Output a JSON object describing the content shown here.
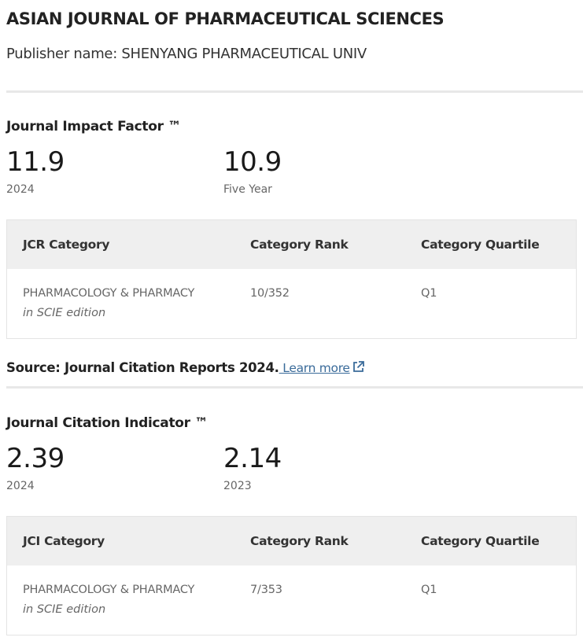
{
  "journal": {
    "title": "ASIAN JOURNAL OF PHARMACEUTICAL SCIENCES",
    "publisher": "Publisher name: SHENYANG PHARMACEUTICAL UNIV"
  },
  "jif": {
    "heading": "Journal Impact Factor ™",
    "primary": {
      "value": "11.9",
      "label": "2024"
    },
    "secondary": {
      "value": "10.9",
      "label": "Five Year"
    },
    "table": {
      "headers": [
        "JCR Category",
        "Category Rank",
        "Category Quartile"
      ],
      "rows": [
        {
          "category": "PHARMACOLOGY & PHARMACY",
          "edition": "in SCIE edition",
          "rank": "10/352",
          "quartile": "Q1"
        }
      ]
    }
  },
  "source": {
    "text": "Source: Journal Citation Reports  2024.",
    "link_label": " Learn more",
    "link_icon": "external-link-icon",
    "link_color": "#3a6b9a"
  },
  "jci": {
    "heading": "Journal Citation Indicator ™",
    "primary": {
      "value": "2.39",
      "label": "2024"
    },
    "secondary": {
      "value": "2.14",
      "label": "2023"
    },
    "table": {
      "headers": [
        "JCI Category",
        "Category Rank",
        "Category Quartile"
      ],
      "rows": [
        {
          "category": "PHARMACOLOGY & PHARMACY",
          "edition": "in SCIE edition",
          "rank": "7/353",
          "quartile": "Q1"
        }
      ]
    }
  }
}
